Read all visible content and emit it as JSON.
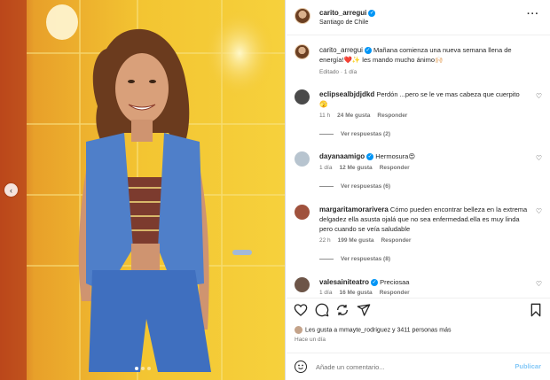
{
  "post": {
    "username": "carito_arregui",
    "location": "Santiago de Chile",
    "caption": "Mañana comienza una nueva semana llena de energía!❤️✨ les mando mucho ánimo🙌🏻",
    "caption_meta": "Editado · 1 día"
  },
  "comments": [
    {
      "username": "eclipsealbjdjdkd",
      "text": "Perdón ...pero se le ve mas cabeza que cuerpito🫣",
      "time": "11 h",
      "likes": "24 Me gusta",
      "reply": "Responder",
      "replies": "Ver respuestas (2)",
      "verified": false
    },
    {
      "username": "dayanaamigo",
      "text": "Hermosura😍",
      "time": "1 día",
      "likes": "12 Me gusta",
      "reply": "Responder",
      "replies": "Ver respuestas (6)",
      "verified": true
    },
    {
      "username": "margaritamorarivera",
      "text": "Cómo pueden encontrar belleza en la extrema delgadez ella asusta ojalá que no sea enfermedad.ella es muy linda pero cuando se veía saludable",
      "time": "22 h",
      "likes": "199 Me gusta",
      "reply": "Responder",
      "replies": "Ver respuestas (8)",
      "verified": false
    },
    {
      "username": "valesainiteatro",
      "text": "Preciosaa",
      "time": "1 día",
      "likes": "16 Me gusta",
      "reply": "Responder",
      "replies": "",
      "verified": true
    }
  ],
  "likes_text": "Les gusta a mmayte_rodriguez y 3411 personas más",
  "post_time": "Hace un día",
  "comment_box": {
    "placeholder": "Añade un comentario...",
    "publish_label": "Publicar"
  },
  "colors": {
    "accent": "#0095f6",
    "publish_disabled": "#84c8f7",
    "muted": "#737373"
  },
  "icons": [
    "heart-icon",
    "comment-icon",
    "share-icon",
    "send-icon",
    "bookmark-icon",
    "emoji-icon",
    "more-icon"
  ]
}
